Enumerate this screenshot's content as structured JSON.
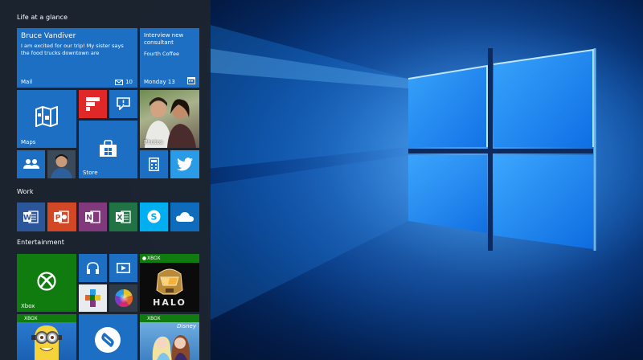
{
  "groups": {
    "life": "Life at a glance",
    "work": "Work",
    "entertainment": "Entertainment"
  },
  "tiles": {
    "mail": {
      "label": "Mail",
      "sender": "Bruce Vandiver",
      "preview": "I am excited for our trip! My sister says the food trucks downtown are",
      "count": "10"
    },
    "calendar": {
      "event": "Interview new consultant",
      "location": "Fourth Coffee",
      "date": "Monday 13"
    },
    "maps": {
      "label": "Maps"
    },
    "photos": {
      "label": "Photos"
    },
    "store": {
      "label": "Store"
    },
    "xbox": {
      "label": "Xbox"
    },
    "xbox_badge": "XBOX",
    "halo": {
      "title": "HALO"
    },
    "disney": {
      "badge": "Disney"
    }
  },
  "colors": {
    "start_bg": "#1c2430",
    "tile_blue": "#1c6fc2",
    "flipboard_red": "#e12828",
    "word": "#2b579a",
    "powerpoint": "#d24726",
    "onenote": "#80397b",
    "excel": "#217346",
    "skype": "#00aff0",
    "onedrive": "#0f6cbd",
    "xbox_green": "#107c10"
  }
}
